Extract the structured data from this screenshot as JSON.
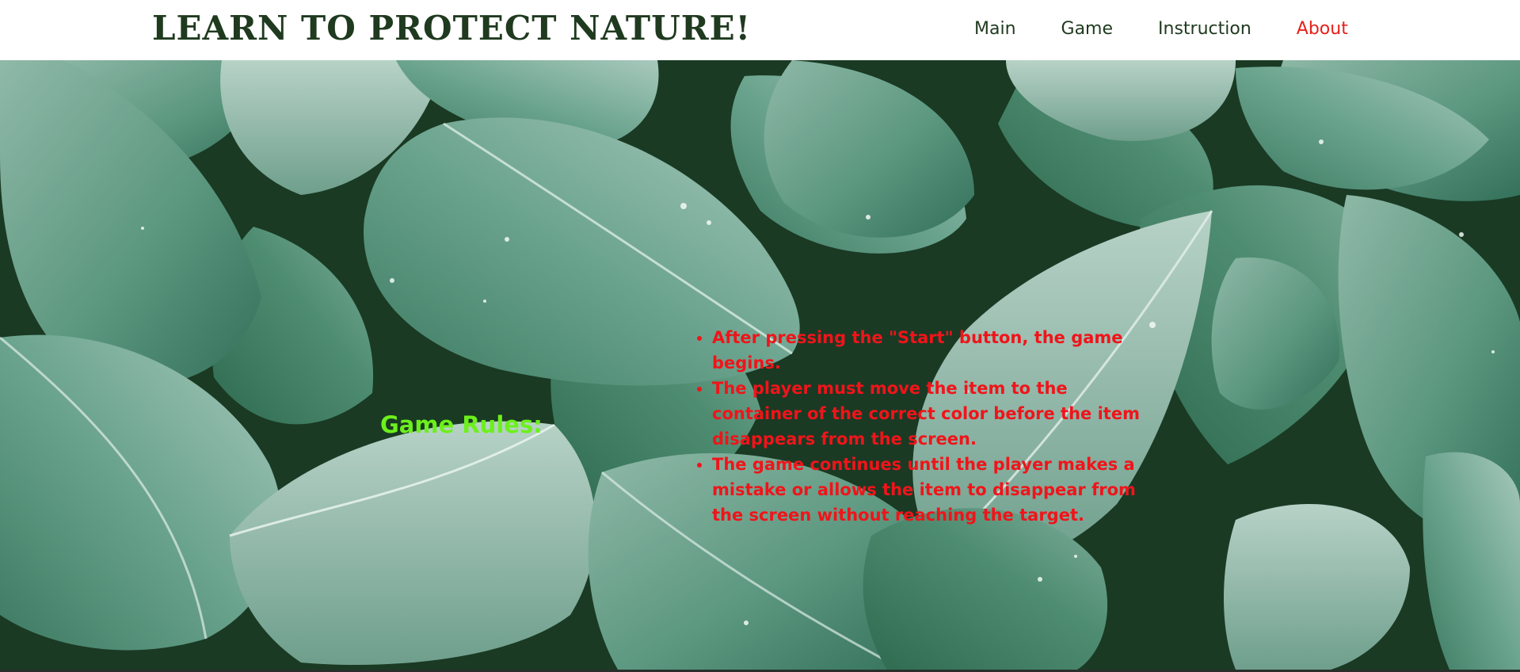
{
  "header": {
    "title": "LEARN TO PROTECT NATURE!",
    "nav": [
      {
        "label": "Main"
      },
      {
        "label": "Game"
      },
      {
        "label": "Instruction"
      },
      {
        "label": "About"
      }
    ],
    "active_nav": "About",
    "colors": {
      "title": "#1f3a1f",
      "nav": "#1f3a1f",
      "active": "#e8201a"
    }
  },
  "main": {
    "background": "hosta-leaves-photo",
    "rules_heading": "Game Rules:",
    "rules": [
      "After pressing the \"Start\" button, the game begins.",
      "The player must move the item to the container of the correct color before the item disappears from the screen.",
      "The game continues until the player makes a mistake or allows the item to disappear from the screen without reaching the target."
    ],
    "colors": {
      "heading": "#6cf01b",
      "rules": "#f0141a"
    }
  }
}
